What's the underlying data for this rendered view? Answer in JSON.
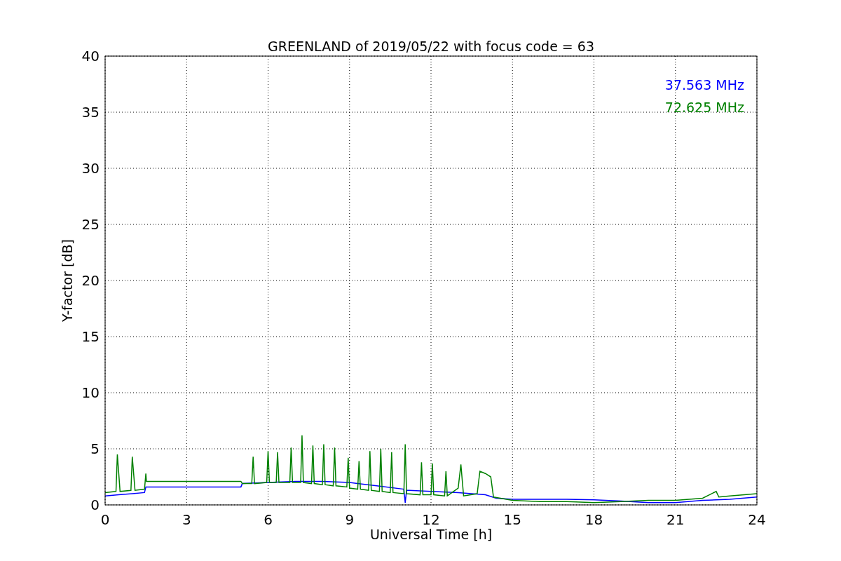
{
  "chart_data": {
    "type": "line",
    "title": "GREENLAND of 2019/05/22 with focus code = 63",
    "xlabel": "Universal Time [h]",
    "ylabel": "Y-factor [dB]",
    "xlim": [
      0,
      24
    ],
    "ylim": [
      0,
      40
    ],
    "xticks": [
      0,
      3,
      6,
      9,
      12,
      15,
      18,
      21,
      24
    ],
    "yticks": [
      0,
      5,
      10,
      15,
      20,
      25,
      30,
      35,
      40
    ],
    "grid": true,
    "series": [
      {
        "name": "37.563 MHz",
        "color": "#0000ff",
        "x": [
          0,
          0.5,
          1,
          1.45,
          1.5,
          5.0,
          5.05,
          6,
          7,
          8,
          9,
          10,
          11,
          11.05,
          11.1,
          11.2,
          12,
          13,
          14,
          14.4,
          15,
          16,
          17,
          18,
          19,
          20,
          21,
          22,
          23,
          24
        ],
        "values": [
          0.8,
          0.9,
          1.0,
          1.1,
          1.6,
          1.6,
          1.9,
          2.0,
          2.1,
          2.1,
          2.0,
          1.7,
          1.4,
          0.2,
          1.3,
          1.3,
          1.2,
          1.1,
          0.9,
          0.6,
          0.5,
          0.5,
          0.5,
          0.45,
          0.35,
          0.2,
          0.2,
          0.4,
          0.5,
          0.7
        ]
      },
      {
        "name": "72.625 MHz",
        "color": "#008000",
        "x": [
          0,
          0.4,
          0.45,
          0.55,
          0.95,
          1.0,
          1.1,
          1.45,
          1.5,
          1.52,
          5.0,
          5.05,
          5.4,
          5.45,
          5.5,
          5.95,
          6.0,
          6.05,
          6.3,
          6.35,
          6.4,
          6.8,
          6.85,
          6.9,
          7.2,
          7.25,
          7.3,
          7.6,
          7.65,
          7.7,
          8.0,
          8.05,
          8.1,
          8.4,
          8.45,
          8.5,
          8.9,
          8.95,
          9.0,
          9.3,
          9.35,
          9.4,
          9.7,
          9.75,
          9.8,
          10.1,
          10.15,
          10.2,
          10.5,
          10.55,
          10.6,
          11.0,
          11.05,
          11.1,
          11.6,
          11.65,
          11.7,
          12.0,
          12.05,
          12.1,
          12.5,
          12.55,
          12.6,
          13.0,
          13.1,
          13.2,
          13.7,
          13.8,
          14.0,
          14.2,
          14.3,
          15,
          16,
          17,
          18,
          19,
          20,
          21,
          22,
          22.5,
          22.6,
          23,
          24
        ],
        "values": [
          1.1,
          1.2,
          4.5,
          1.2,
          1.3,
          4.3,
          1.3,
          1.4,
          2.8,
          2.1,
          2.1,
          1.9,
          1.9,
          4.3,
          1.9,
          2.0,
          4.8,
          2.0,
          2.0,
          4.7,
          2.0,
          2.0,
          5.1,
          2.0,
          2.0,
          6.2,
          2.0,
          1.9,
          5.3,
          1.9,
          1.8,
          5.4,
          1.8,
          1.7,
          5.1,
          1.7,
          1.6,
          4.2,
          1.5,
          1.4,
          3.9,
          1.4,
          1.3,
          4.8,
          1.3,
          1.2,
          5.0,
          1.2,
          1.1,
          4.7,
          1.1,
          1.0,
          5.4,
          1.0,
          0.9,
          3.8,
          0.9,
          0.9,
          3.7,
          0.9,
          0.8,
          3.0,
          0.8,
          1.5,
          3.6,
          0.8,
          1.0,
          3.0,
          2.8,
          2.5,
          0.7,
          0.4,
          0.3,
          0.3,
          0.2,
          0.3,
          0.4,
          0.4,
          0.6,
          1.2,
          0.7,
          0.8,
          1.0
        ]
      }
    ]
  }
}
